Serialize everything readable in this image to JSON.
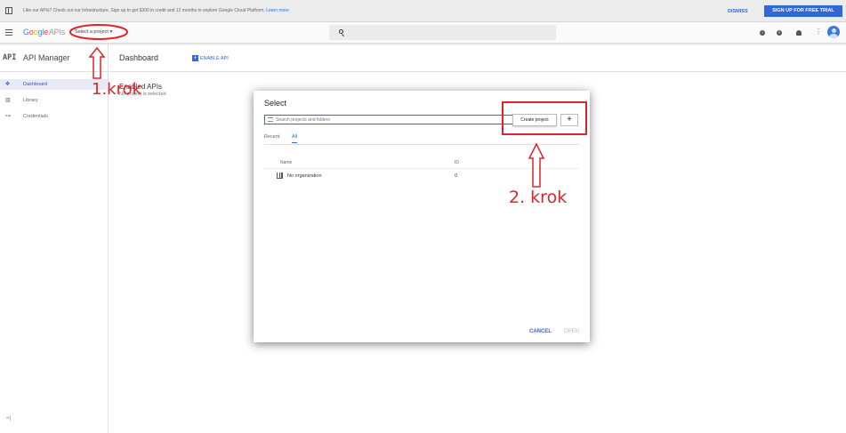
{
  "promo": {
    "text": "Like our APIs? Check out our Infrastructure. Sign up to get $300 in credit and 12 months to explore Google Cloud Platform.",
    "learn_more": "Learn more",
    "dismiss": "DISMISS",
    "trial": "SIGN UP FOR FREE TRIAL"
  },
  "header": {
    "logo": "Google",
    "logo_suffix": "APIs",
    "project_select": "Select a project",
    "icons": [
      "menu-icon",
      "search-icon",
      "info-icon",
      "help-icon",
      "bell-icon",
      "more-icon",
      "account-icon"
    ]
  },
  "sidebar": {
    "api_badge": "API",
    "title": "API Manager",
    "items": [
      {
        "label": "Dashboard",
        "icon": "dashboard-icon",
        "active": true
      },
      {
        "label": "Library",
        "icon": "library-icon",
        "active": false
      },
      {
        "label": "Credentials",
        "icon": "key-icon",
        "active": false
      }
    ],
    "collapse": "<|"
  },
  "content": {
    "title": "Dashboard",
    "enable_api": "ENABLE API",
    "enabled_title": "Enabled APIs",
    "enabled_sub": "No project is selected"
  },
  "dialog": {
    "title": "Select",
    "search_placeholder": "Search projects and folders",
    "create_project": "Create project",
    "plus": "+",
    "tabs": [
      "Recent",
      "All"
    ],
    "active_tab": "All",
    "columns": [
      "Name",
      "ID"
    ],
    "rows": [
      {
        "name": "No organization",
        "id": "0"
      }
    ],
    "cancel": "CANCEL",
    "open": "OPEN"
  },
  "annotations": {
    "step1": "1.krok",
    "step2": "2. krok",
    "color": "#e0232b"
  },
  "colors": {
    "accent": "#3367d6",
    "annotation": "#e0232b"
  }
}
